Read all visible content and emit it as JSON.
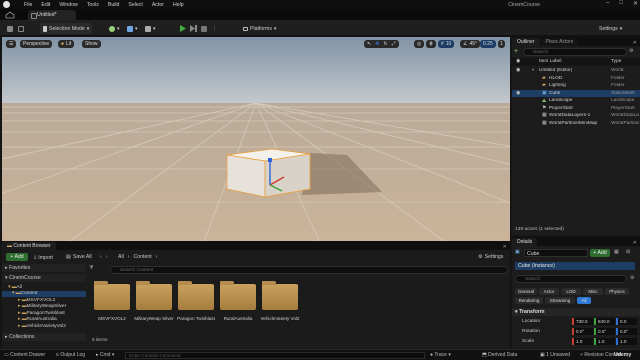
{
  "menubar": {
    "items": [
      "File",
      "Edit",
      "Window",
      "Tools",
      "Build",
      "Select",
      "Actor",
      "Help"
    ],
    "project_title": "CinemCourse"
  },
  "tab": {
    "label": "Untitled*"
  },
  "toolbar": {
    "mode_label": "Selection Mode",
    "platforms_label": "Platforms",
    "settings_label": "Settings"
  },
  "viewport": {
    "perspective_label": "Perspective",
    "lit_label": "Lit",
    "show_label": "Show",
    "snap_grid": "10",
    "snap_rot": "45°",
    "snap_scale": "0.25",
    "camera_speed": "1"
  },
  "outliner": {
    "tabs": [
      "Outliner",
      "Place Actors"
    ],
    "search_placeholder": "Search",
    "col_label": "Item Label",
    "col_type": "Type",
    "rows": [
      {
        "label": "Untitled (Editor)",
        "type": "World"
      },
      {
        "label": "HLOD",
        "type": "Folder"
      },
      {
        "label": "Lighting",
        "type": "Folder"
      },
      {
        "label": "Cube",
        "type": "StaticMesh"
      },
      {
        "label": "Landscape",
        "type": "Landscape"
      },
      {
        "label": "PlayerStart",
        "type": "PlayerStart"
      },
      {
        "label": "WorldDataLayers-1",
        "type": "WorldDataLayers"
      },
      {
        "label": "WorldPartitionMiniMap",
        "type": "WorldPartitionMiniMap"
      }
    ],
    "status": "139 actors (1 selected)"
  },
  "details": {
    "tab_label": "Details",
    "object_name": "Cube",
    "add_label": "+ Add",
    "instance_label": "Cube (Instance)",
    "search_placeholder": "Search",
    "filter_tabs": [
      "General",
      "Actor",
      "LOD",
      "Misc",
      "Physics",
      "Rendering",
      "Streaming",
      "All"
    ],
    "section": "Transform",
    "location": {
      "label": "Location",
      "x": "730.0",
      "y": "840.0",
      "z": "0.0"
    },
    "rotation": {
      "label": "Rotation",
      "x": "0.0°",
      "y": "0.0°",
      "z": "0.0°"
    },
    "scale": {
      "label": "Scale",
      "x": "1.0",
      "y": "1.0",
      "z": "1.0"
    }
  },
  "content_browser": {
    "tab_label": "Content Browser",
    "add_label": "+ Add",
    "import_label": "Import",
    "save_all_label": "Save All",
    "path_all": "All",
    "path_content": "Content",
    "settings_label": "Settings",
    "favorites_label": "Favorites",
    "project_label": "CinemCourse",
    "tree": [
      "All",
      "Content",
      "MSVFXVOL2",
      "MilitaryWeapSilver",
      "ParagonTwinblast",
      "RuralAustralia",
      "VehicleVarietyVol2"
    ],
    "search_placeholder": "Search Content",
    "folders": [
      "MSVFXVOL2",
      "MilitaryWeap Silver",
      "Paragon Twinblast",
      "RuralAustralia",
      "VehicleVariety Vol2"
    ],
    "item_count": "5 items",
    "collections_label": "Collections"
  },
  "statusbar": {
    "content_drawer": "Content Drawer",
    "output_log": "Output Log",
    "cmd": "Cmd",
    "console_placeholder": "Enter Console Command",
    "trace": "Trace",
    "derived_data": "Derived Data",
    "unsaved": "1 Unsaved",
    "revision": "Revision Control"
  },
  "watermark": "Udemy",
  "colors": {
    "accent_blue": "#2d7ad6",
    "play_green": "#3fae3f",
    "folder": "#c9a15e"
  }
}
